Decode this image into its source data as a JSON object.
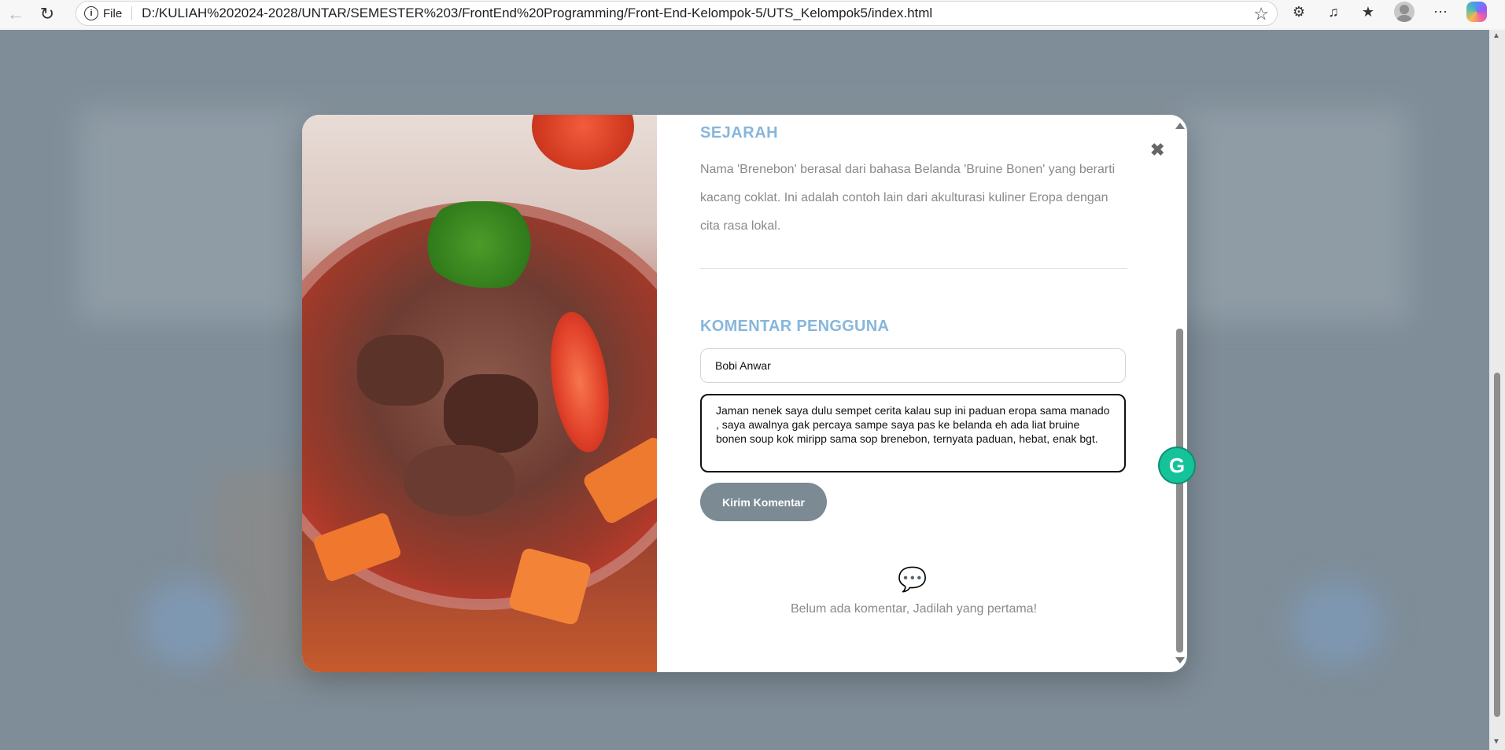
{
  "browser": {
    "back_icon": "arrow-left-icon",
    "reload_icon": "reload-icon",
    "file_label": "File",
    "url": "D:/KULIAH%202024-2028/UNTAR/SEMESTER%203/FrontEnd%20Programming/Front-End-Kelompok-5/UTS_Kelompok5/index.html"
  },
  "modal": {
    "close_symbol": "✖",
    "sejarah_title": "SEJARAH",
    "sejarah_text": "Nama 'Brenebon' berasal dari bahasa Belanda 'Bruine Bonen' yang berarti kacang coklat. Ini adalah contoh lain dari akulturasi kuliner Eropa dengan cita rasa lokal.",
    "komentar_title": "KOMENTAR PENGGUNA",
    "name_value": "Bobi Anwar",
    "comment_value": "Jaman nenek saya dulu sempet cerita kalau sup ini paduan eropa sama manado , saya awalnya gak percaya sampe saya pas ke belanda eh ada liat bruine bonen soup kok miripp sama sop brenebon, ternyata paduan, hebat, enak bgt.",
    "submit_label": "Kirim Komentar",
    "empty_text": "Belum ada komentar, Jadilah yang pertama!"
  },
  "grammarly": {
    "label": "G"
  }
}
